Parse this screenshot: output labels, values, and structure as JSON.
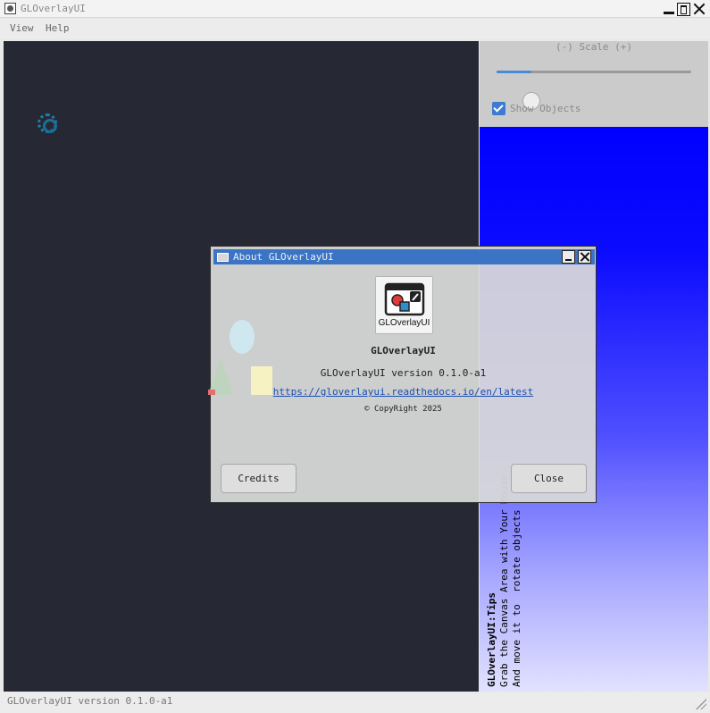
{
  "window": {
    "title": "GLOverlayUI"
  },
  "menu": {
    "items": [
      {
        "label": "View"
      },
      {
        "label": "Help"
      }
    ]
  },
  "panel": {
    "scale_label": "(-) Scale (+)",
    "scale_level": 0.18,
    "show_objects_label": "Show Objects",
    "show_objects_checked": true
  },
  "tips": {
    "title": "GLOverlayUI:Tips",
    "lines": [
      "Grab the Canvas Area with Your Mouse",
      "And move it to  rotate objects"
    ]
  },
  "status": {
    "text": "GLOverlayUI version  0.1.0-a1"
  },
  "about_dialog": {
    "title": "About GLOverlayUI",
    "logo_text": "GLOverlayUI",
    "app_name": "GLOverlayUI",
    "version": "GLOverlayUI version 0.1.0-a1",
    "url": "https://gloverlayui.readthedocs.io/en/latest",
    "copyright": "© CopyRight 2025",
    "credits_button": "Credits",
    "close_button": "Close"
  },
  "colors": {
    "canvas_bg": "#262933",
    "accent": "#3b74c5",
    "gradient_top": "#0000ff",
    "gradient_bottom": "#e2e2ff"
  }
}
